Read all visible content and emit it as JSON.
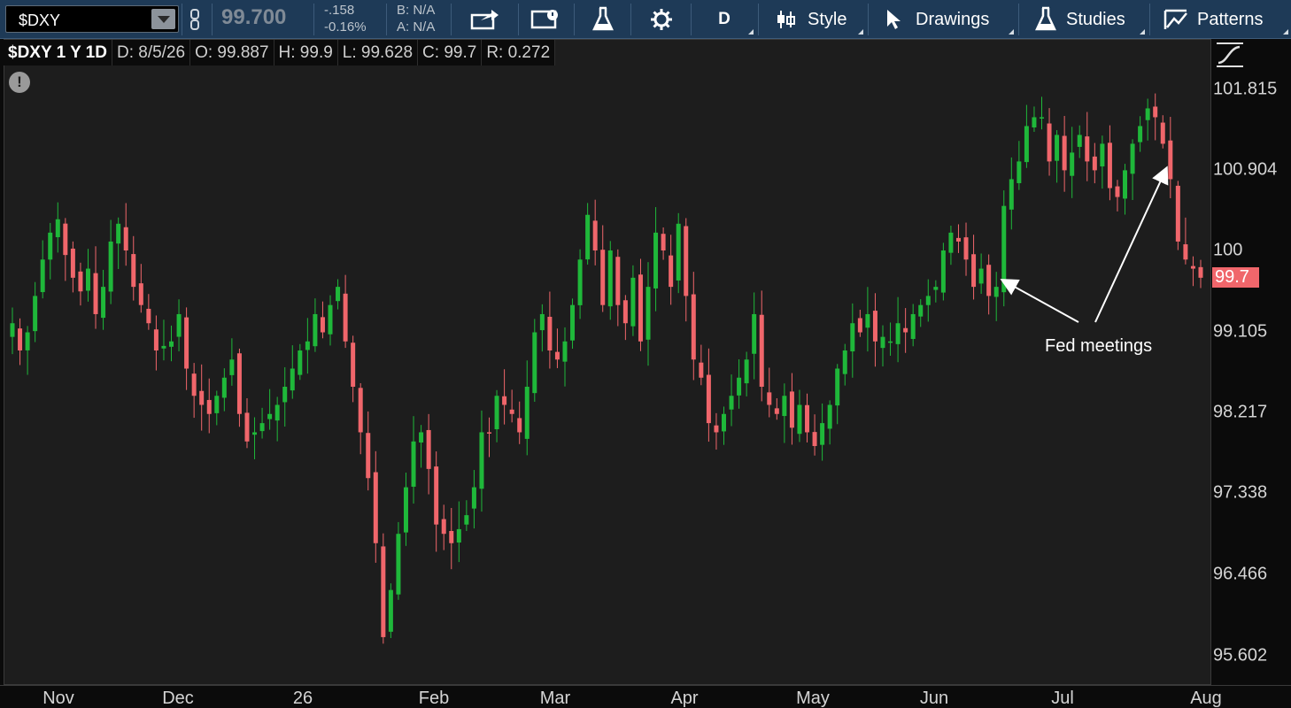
{
  "toolbar": {
    "symbol": "$DXY",
    "last_price": "99.700",
    "change": "-.158",
    "change_pct": "-0.16%",
    "bid": "B: N/A",
    "ask": "A: N/A",
    "aggregation": "D",
    "style_label": "Style",
    "drawings_label": "Drawings",
    "studies_label": "Studies",
    "patterns_label": "Patterns"
  },
  "info": {
    "title": "$DXY 1 Y 1D",
    "date": "D: 8/5/26",
    "open": "O: 99.887",
    "high": "H: 99.9",
    "low": "L: 99.628",
    "close": "C: 99.7",
    "range": "R: 0.272"
  },
  "alert_icon": "!",
  "last_badge": "99.7",
  "annotation": "Fed meetings",
  "colors": {
    "up": "#1fb83a",
    "down": "#f0666b",
    "background": "#1d1d1d",
    "toolbar": "#1e3a57"
  },
  "chart_data": {
    "type": "candlestick",
    "symbol": "$DXY",
    "period": "1 Y",
    "interval": "1D",
    "price_ticks": [
      "101.815",
      "100.904",
      "100",
      "99.105",
      "98.217",
      "97.338",
      "96.466",
      "95.602"
    ],
    "time_ticks": [
      "Nov",
      "Dec",
      "26",
      "Feb",
      "Mar",
      "Apr",
      "May",
      "Jun",
      "Jul",
      "Aug"
    ],
    "ylim": [
      95.2,
      102.4
    ],
    "last_price": 99.7,
    "closes": [
      99.2,
      98.9,
      99.1,
      99.5,
      99.9,
      100.2,
      100.35,
      99.95,
      99.7,
      99.55,
      99.8,
      99.3,
      99.6,
      100.1,
      100.3,
      100.0,
      99.6,
      99.4,
      99.2,
      98.9,
      98.95,
      99.0,
      99.3,
      98.7,
      98.4,
      98.3,
      98.2,
      98.4,
      98.6,
      98.8,
      98.2,
      97.9,
      98.0,
      98.1,
      98.2,
      98.3,
      98.5,
      98.7,
      98.9,
      99.0,
      99.3,
      99.1,
      99.4,
      99.6,
      99.0,
      98.5,
      98.0,
      97.5,
      96.8,
      95.8,
      96.3,
      96.9,
      97.4,
      97.9,
      98.0,
      97.6,
      97.0,
      96.9,
      96.8,
      96.95,
      97.1,
      97.4,
      98.0,
      98.0,
      98.4,
      98.3,
      98.2,
      98.0,
      98.5,
      99.1,
      99.3,
      98.9,
      98.8,
      99.0,
      99.4,
      99.9,
      100.4,
      100.0,
      99.4,
      100.0,
      99.4,
      99.2,
      99.7,
      99.0,
      99.6,
      100.2,
      100.0,
      99.6,
      100.3,
      99.5,
      98.8,
      98.6,
      98.1,
      98.0,
      98.2,
      98.4,
      98.6,
      98.8,
      99.3,
      98.5,
      98.3,
      98.2,
      98.4,
      98.05,
      98.3,
      98.0,
      97.85,
      98.1,
      98.3,
      98.7,
      98.9,
      99.2,
      99.1,
      99.3,
      99.0,
      99.05,
      99.0,
      99.2,
      99.1,
      99.3,
      99.4,
      99.5,
      99.6,
      100.0,
      100.2,
      100.1,
      99.9,
      99.6,
      99.8,
      99.5,
      99.6,
      100.5,
      100.8,
      101.0,
      101.4,
      101.5,
      101.5,
      101.0,
      101.3,
      100.9,
      101.1,
      101.3,
      101.0,
      100.9,
      101.2,
      100.7,
      100.6,
      100.9,
      101.2,
      101.4,
      101.6,
      101.5,
      101.2,
      100.8,
      100.1,
      99.9,
      99.8,
      99.7
    ]
  }
}
